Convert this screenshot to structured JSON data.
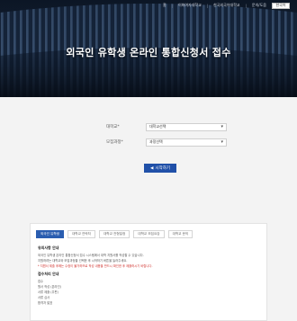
{
  "header": {
    "links": [
      "홈",
      "이화여자대학교",
      "한국외국어대학교",
      "문의/도움"
    ],
    "language": "한국어",
    "title": "외국인 유학생 온라인 통합신청서 접수"
  },
  "form": {
    "field1": {
      "label": "대학교*",
      "value": "대학교선택"
    },
    "field2": {
      "label": "모집과정*",
      "value": "과정선택"
    },
    "start_button": "시작하기"
  },
  "tabs": [
    "외국인 유학생",
    "대학교 연락처",
    "대학교 전형일정",
    "대학교 모집요강",
    "대학교 문의"
  ],
  "info": {
    "heading1": "유의사항 안내",
    "lines1": [
      "외국인 유학생 온라인 통합신청서 접수 시스템에서 대학 지원서를 작성할 수 있습니다.",
      "지원하려는 대학교와 모집과정을 선택한 후 시작하기 버튼을 눌러주세요."
    ],
    "warning": "* 지원서 제출 후에는 수정이 불가하므로 작성 내용을 반드시 확인한 후 제출하시기 바랍니다.",
    "heading2": "접수처리 안내",
    "lines2": [
      "접수",
      "원서 작성 (온라인)",
      "서류 제출 (우편)",
      "서류 심사",
      "합격자 발표"
    ]
  }
}
